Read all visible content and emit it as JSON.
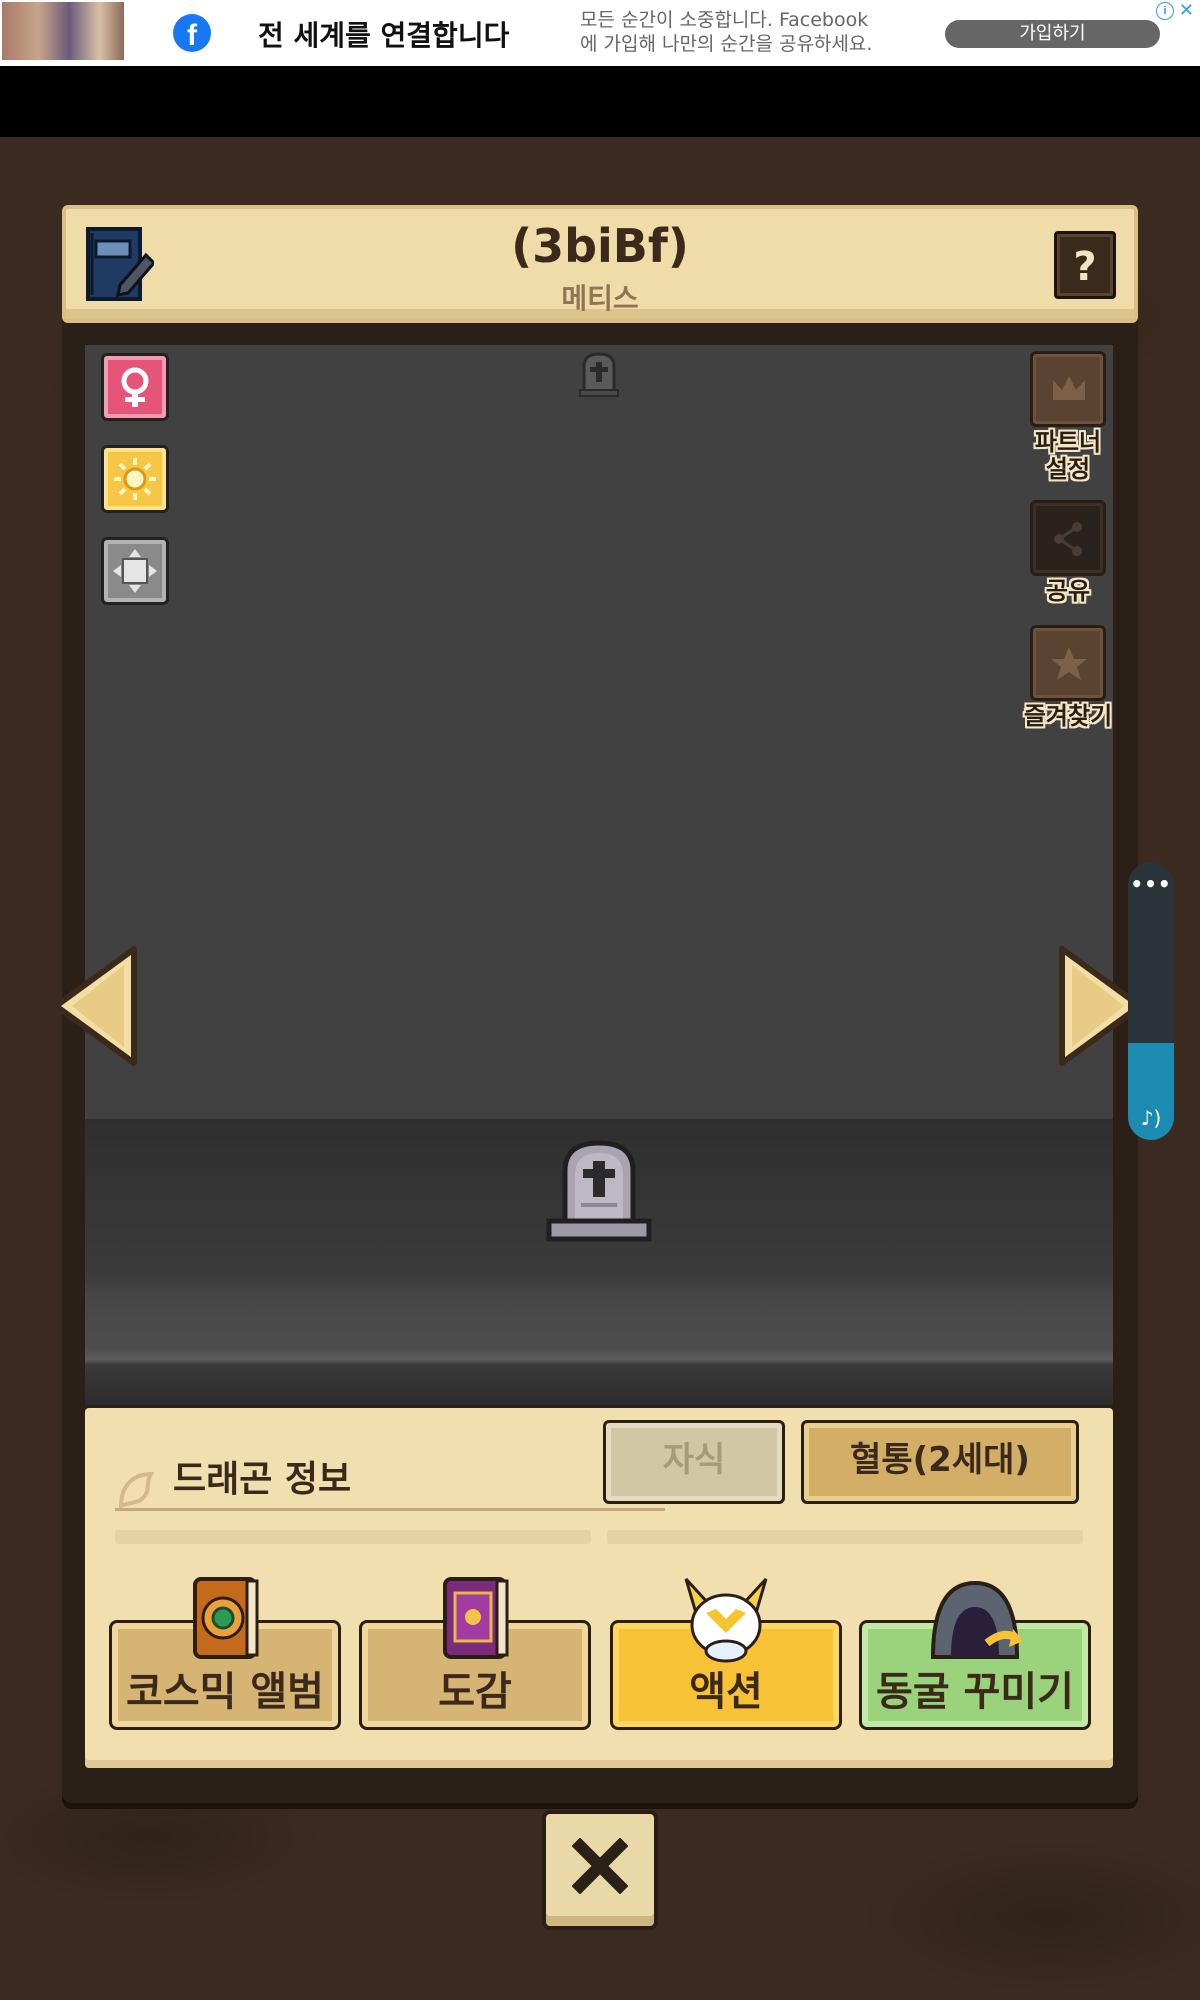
{
  "ad": {
    "title": "전 세계를 연결합니다",
    "description": "모든 순간이 소중합니다. Facebook에 가입해 나만의 순간을 공유하세요.",
    "cta": "가입하기",
    "info_icon": "i",
    "close_icon": "✕",
    "brand_icon": "f"
  },
  "header": {
    "title": "(3biBf)",
    "subtitle": "메티스",
    "help_label": "?"
  },
  "side_buttons": {
    "partner": [
      "파트너",
      "설정"
    ],
    "share": "공유",
    "favorite": "즐겨찾기"
  },
  "music": {
    "dots": "•••",
    "note": "♪)"
  },
  "info": {
    "title": "드래곤 정보",
    "tab_child": "자식",
    "tab_bloodline": "혈통(2세대)"
  },
  "menu": {
    "album": "코스믹 앨범",
    "dex": "도감",
    "action": "액션",
    "cave": "동굴 꾸미기"
  },
  "colors": {
    "header_bg": "#f0dca9",
    "scene_bg": "#414141",
    "action_yellow": "#f7c235",
    "cave_green": "#9bd27c",
    "facebook_blue": "#1877f2"
  }
}
